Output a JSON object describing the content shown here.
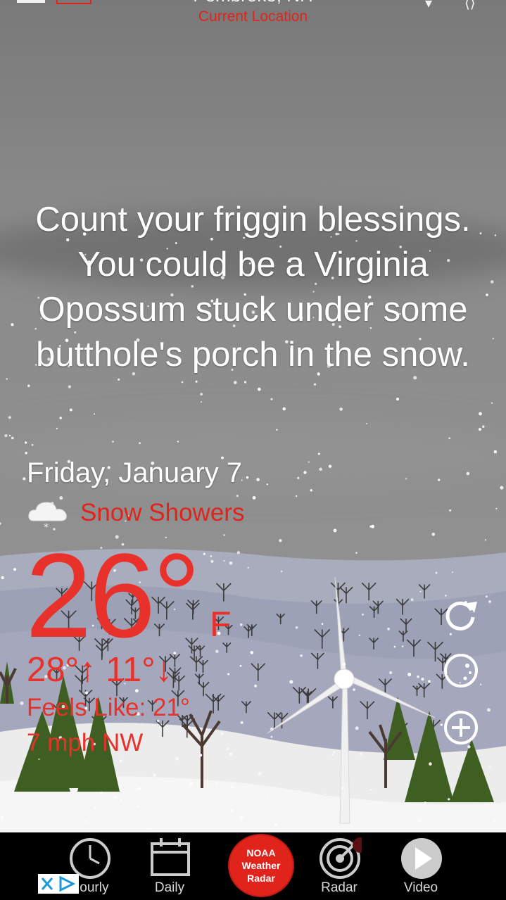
{
  "header": {
    "location": "Pembroke, NH",
    "subtitle": "Current Location"
  },
  "quote": "Count your friggin blessings. You could be a Virginia Opossum stuck under some butthole's porch in the snow.",
  "weather": {
    "date": "Friday, January 7",
    "condition": "Snow Showers",
    "condition_icon": "snow-cloud-icon",
    "temperature": "26°",
    "unit": "F",
    "hilo": "28°↑ 11°↓",
    "feels_like": "Feels Like: 21°",
    "wind": "7 mph NW"
  },
  "side_buttons": [
    "refresh-icon",
    "moon-phase-icon",
    "add-icon"
  ],
  "tabs": [
    {
      "label": "Hourly",
      "icon": "clock-icon"
    },
    {
      "label": "Daily",
      "icon": "calendar-icon"
    },
    {
      "label": "Radar",
      "icon": "radar-icon"
    },
    {
      "label": "Video",
      "icon": "play-icon"
    }
  ],
  "noaa_button": {
    "line1": "NOAA",
    "line2": "Weather",
    "line3": "Radar"
  },
  "colors": {
    "accent": "#e0231b",
    "tabbar": "#000000"
  }
}
